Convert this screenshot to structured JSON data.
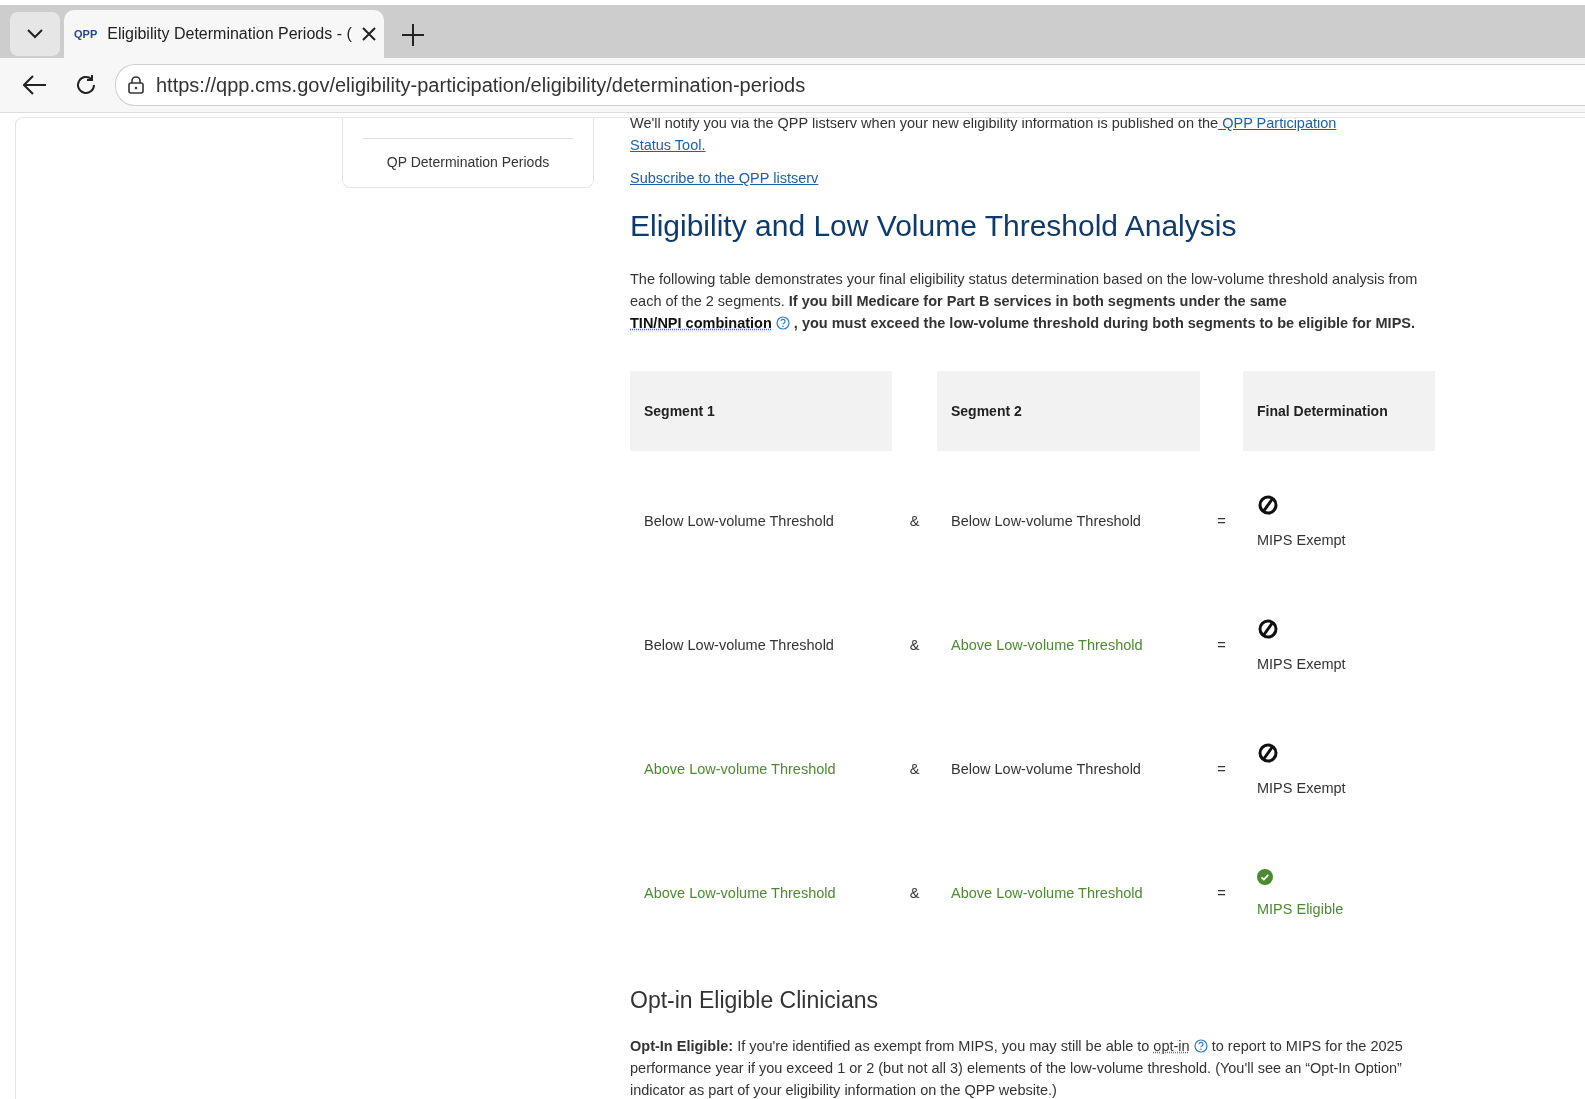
{
  "browser": {
    "tab": {
      "favicon": "QPP",
      "title": "Eligibility Determination Periods - (",
      "selected": true
    },
    "url": "https://qpp.cms.gov/eligibility-participation/eligibility/determination-periods"
  },
  "sidebar": {
    "items": [
      {
        "label": "QP Determination Periods"
      }
    ]
  },
  "notice": {
    "text": "We'll notify you via the QPP listserv when your new eligibility information is published on the",
    "link_lines": [
      " QPP Participation",
      "Status Tool."
    ]
  },
  "subscribe_link": "Subscribe to the QPP listserv",
  "heading": "Eligibility and Low Volume Threshold Analysis",
  "description": {
    "before": "The following table demonstrates your final eligibility status determination based on the low-volume threshold analysis from each of the 2 segments. **If you bill Medicare for Part B services in both segments under the same**",
    "term": "TIN/NPI combination",
    "after": ", you must exceed the low-volume threshold during both segments to be eligible for MIPS."
  },
  "table": {
    "columns": [
      "Segment 1",
      "Segment 2",
      "Final Determination"
    ],
    "rows": [
      {
        "segment_1": {
          "text": "Below Low-volume Threshold",
          "kind": "below"
        },
        "operator_1": "&",
        "segment_2": {
          "text": "Below Low-volume Threshold",
          "kind": "below"
        },
        "operator_2": "=",
        "final": {
          "text": "MIPS Exempt",
          "kind": "exempt"
        }
      },
      {
        "segment_1": {
          "text": "Below Low-volume Threshold",
          "kind": "below"
        },
        "operator_1": "&",
        "segment_2": {
          "text": "Above Low-volume Threshold",
          "kind": "above"
        },
        "operator_2": "=",
        "final": {
          "text": "MIPS Exempt",
          "kind": "exempt"
        }
      },
      {
        "segment_1": {
          "text": "Above Low-volume Threshold",
          "kind": "above"
        },
        "operator_1": "&",
        "segment_2": {
          "text": "Below Low-volume Threshold",
          "kind": "below"
        },
        "operator_2": "=",
        "final": {
          "text": "MIPS Exempt",
          "kind": "exempt"
        }
      },
      {
        "segment_1": {
          "text": "Above Low-volume Threshold",
          "kind": "above"
        },
        "operator_1": "&",
        "segment_2": {
          "text": "Above Low-volume Threshold",
          "kind": "above"
        },
        "operator_2": "=",
        "final": {
          "text": "MIPS Eligible",
          "kind": "eligible"
        }
      }
    ]
  },
  "opt_in": {
    "heading": "Opt-in Eligible Clinicians",
    "before": "**Opt-In Eligible:** If you're identified as exempt from MIPS, you may still be able to",
    "term": "opt-in",
    "after": "to report to MIPS for the 2025 performance year if you exceed 1 or 2 (but not all 3) elements of the low-volume threshold. (You'll see an “Opt-In Option” indicator as part of your eligibility information on the QPP website.)"
  }
}
